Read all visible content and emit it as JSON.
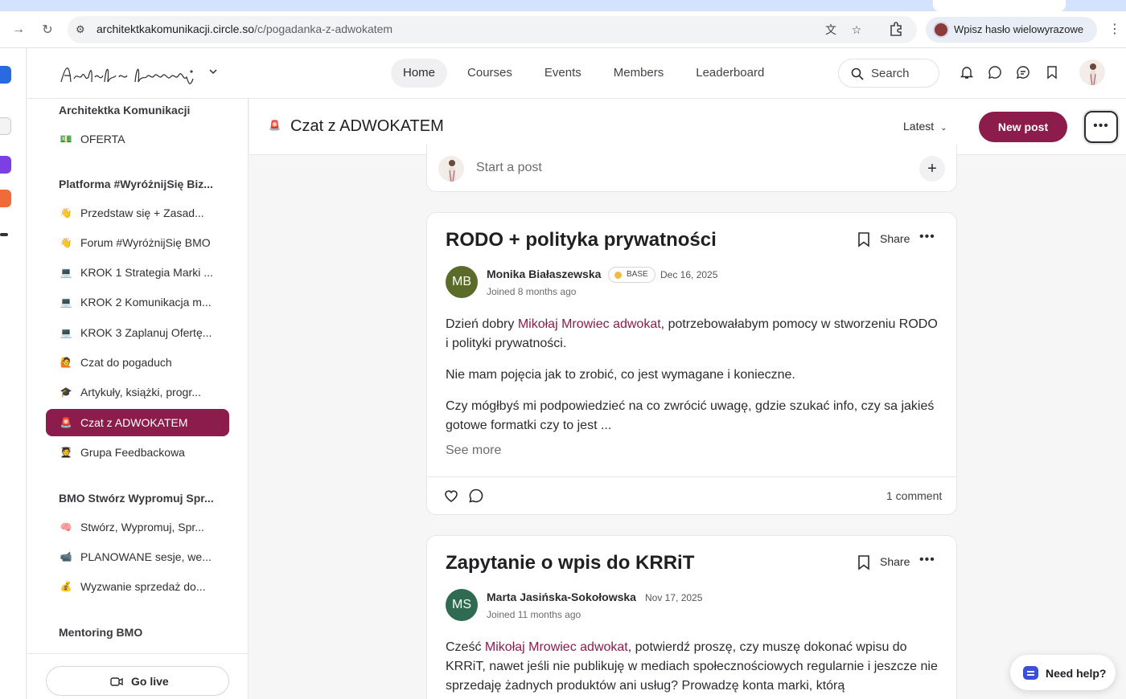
{
  "browser": {
    "url_host": "architektkakomunikacji.circle.so",
    "url_path": "/c/pogadanka-z-adwokatem",
    "profile_label": "Wpisz hasło wielowyrazowe"
  },
  "header": {
    "nav": [
      "Home",
      "Courses",
      "Events",
      "Members",
      "Leaderboard"
    ],
    "search_label": "Search"
  },
  "sidebar": {
    "sections": [
      {
        "title": "Architektka Komunikacji"
      },
      {
        "title": "Platforma #WyróżnijSię Biz..."
      },
      {
        "title": "BMO Stwórz Wypromuj Spr..."
      },
      {
        "title": "Mentoring BMO"
      }
    ],
    "items": [
      {
        "emoji": "💵",
        "label": "OFERTA"
      },
      {
        "emoji": "👋",
        "label": "Przedstaw się + Zasad..."
      },
      {
        "emoji": "👋",
        "label": "Forum #WyróżnijSię BMO"
      },
      {
        "emoji": "💻",
        "label": "KROK 1 Strategia Marki ..."
      },
      {
        "emoji": "💻",
        "label": "KROK 2 Komunikacja m..."
      },
      {
        "emoji": "💻",
        "label": "KROK 3 Zaplanuj Ofertę..."
      },
      {
        "emoji": "🙋",
        "label": "Czat do pogaduch"
      },
      {
        "emoji": "🎓",
        "label": "Artykuły, książki, progr..."
      },
      {
        "emoji": "🚨",
        "label": "Czat z ADWOKATEM"
      },
      {
        "emoji": "🧑‍🎓",
        "label": "Grupa Feedbackowa"
      },
      {
        "emoji": "🧠",
        "label": "Stwórz, Wypromuj, Spr..."
      },
      {
        "emoji": "📹",
        "label": "PLANOWANE sesje, we..."
      },
      {
        "emoji": "💰",
        "label": "Wyzwanie sprzedaż do..."
      }
    ],
    "go_live": "Go live"
  },
  "space": {
    "emoji": "🚨",
    "title": "Czat z ADWOKATEM",
    "sort": "Latest",
    "new_post": "New post"
  },
  "composer": {
    "placeholder": "Start a post"
  },
  "posts": [
    {
      "title": "RODO + polityka prywatności",
      "share": "Share",
      "author_initials": "MB",
      "author": "Monika Białaszewska",
      "badge": "BASE",
      "date": "Dec 16, 2025",
      "joined": "Joined 8 months ago",
      "p1_pre": "Dzień dobry ",
      "p1_mention": "Mikołaj Mrowiec adwokat",
      "p1_post": ", potrzebowałabym pomocy w stworzeniu RODO i polityki prywatności.",
      "p2": "Nie mam pojęcia jak to zrobić, co jest wymagane i konieczne.",
      "p3": "Czy mógłbyś mi podpowiedzieć na co zwrócić uwagę, gdzie szukać info, czy sa jakieś gotowe formatki czy to jest ...",
      "see_more": "See more",
      "comments": "1 comment",
      "avatar_color": "#5a6b2a"
    },
    {
      "title": "Zapytanie o wpis do KRRiT",
      "share": "Share",
      "author_initials": "MS",
      "author": "Marta Jasińska-Sokołowska",
      "date": "Nov 17, 2025",
      "joined": "Joined 11 months ago",
      "p1_pre": "Cześć ",
      "p1_mention": "Mikołaj Mrowiec adwokat",
      "p1_post": ", potwierdź proszę, czy muszę dokonać wpisu do KRRiT, nawet jeśli nie publikuję w mediach społecznościowych regularnie i jeszcze nie sprzedaję żadnych produktów ani usług? Prowadzę konta marki, którą",
      "avatar_color": "#2f6b52"
    }
  ],
  "help": {
    "label": "Need help?"
  },
  "colors": {
    "accent": "#8c1c4b",
    "mention": "#8c1c4b"
  }
}
